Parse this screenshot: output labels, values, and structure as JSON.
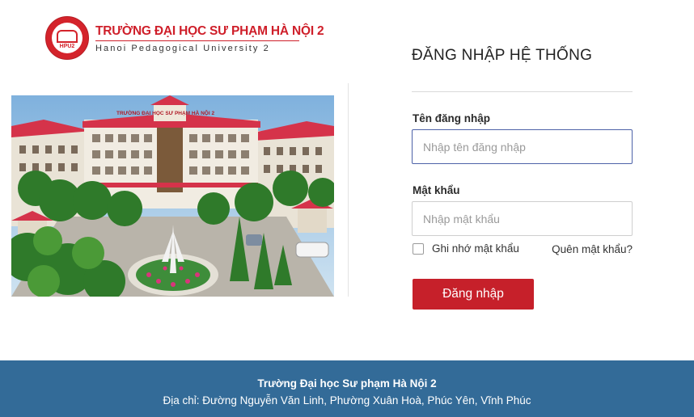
{
  "logo": {
    "name_vi": "TRƯỜNG ĐẠI HỌC SƯ PHẠM HÀ NỘI 2",
    "name_en": "Hanoi Pedagogical University 2",
    "emblem_abbr": "HPU2"
  },
  "campus_image": {
    "building_sign": "TRƯỜNG ĐẠI HỌC SƯ PHẠM HÀ NỘI 2"
  },
  "login": {
    "title": "ĐĂNG NHẬP HỆ THỐNG",
    "username_label": "Tên đăng nhập",
    "username_placeholder": "Nhập tên đăng nhập",
    "password_label": "Mật khẩu",
    "password_placeholder": "Nhập mật khẩu",
    "remember_label": "Ghi nhớ mật khẩu",
    "forgot_label": "Quên mật khẩu?",
    "submit_label": "Đăng nhập"
  },
  "footer": {
    "title": "Trường Đại học Sư phạm Hà Nội 2",
    "address": "Địa chỉ: Đường Nguyễn Văn Linh, Phường Xuân Hoà, Phúc Yên, Vĩnh Phúc"
  },
  "colors": {
    "brand_red": "#c6202a",
    "footer_blue": "#336b98",
    "focus_border": "#4d62a8"
  }
}
